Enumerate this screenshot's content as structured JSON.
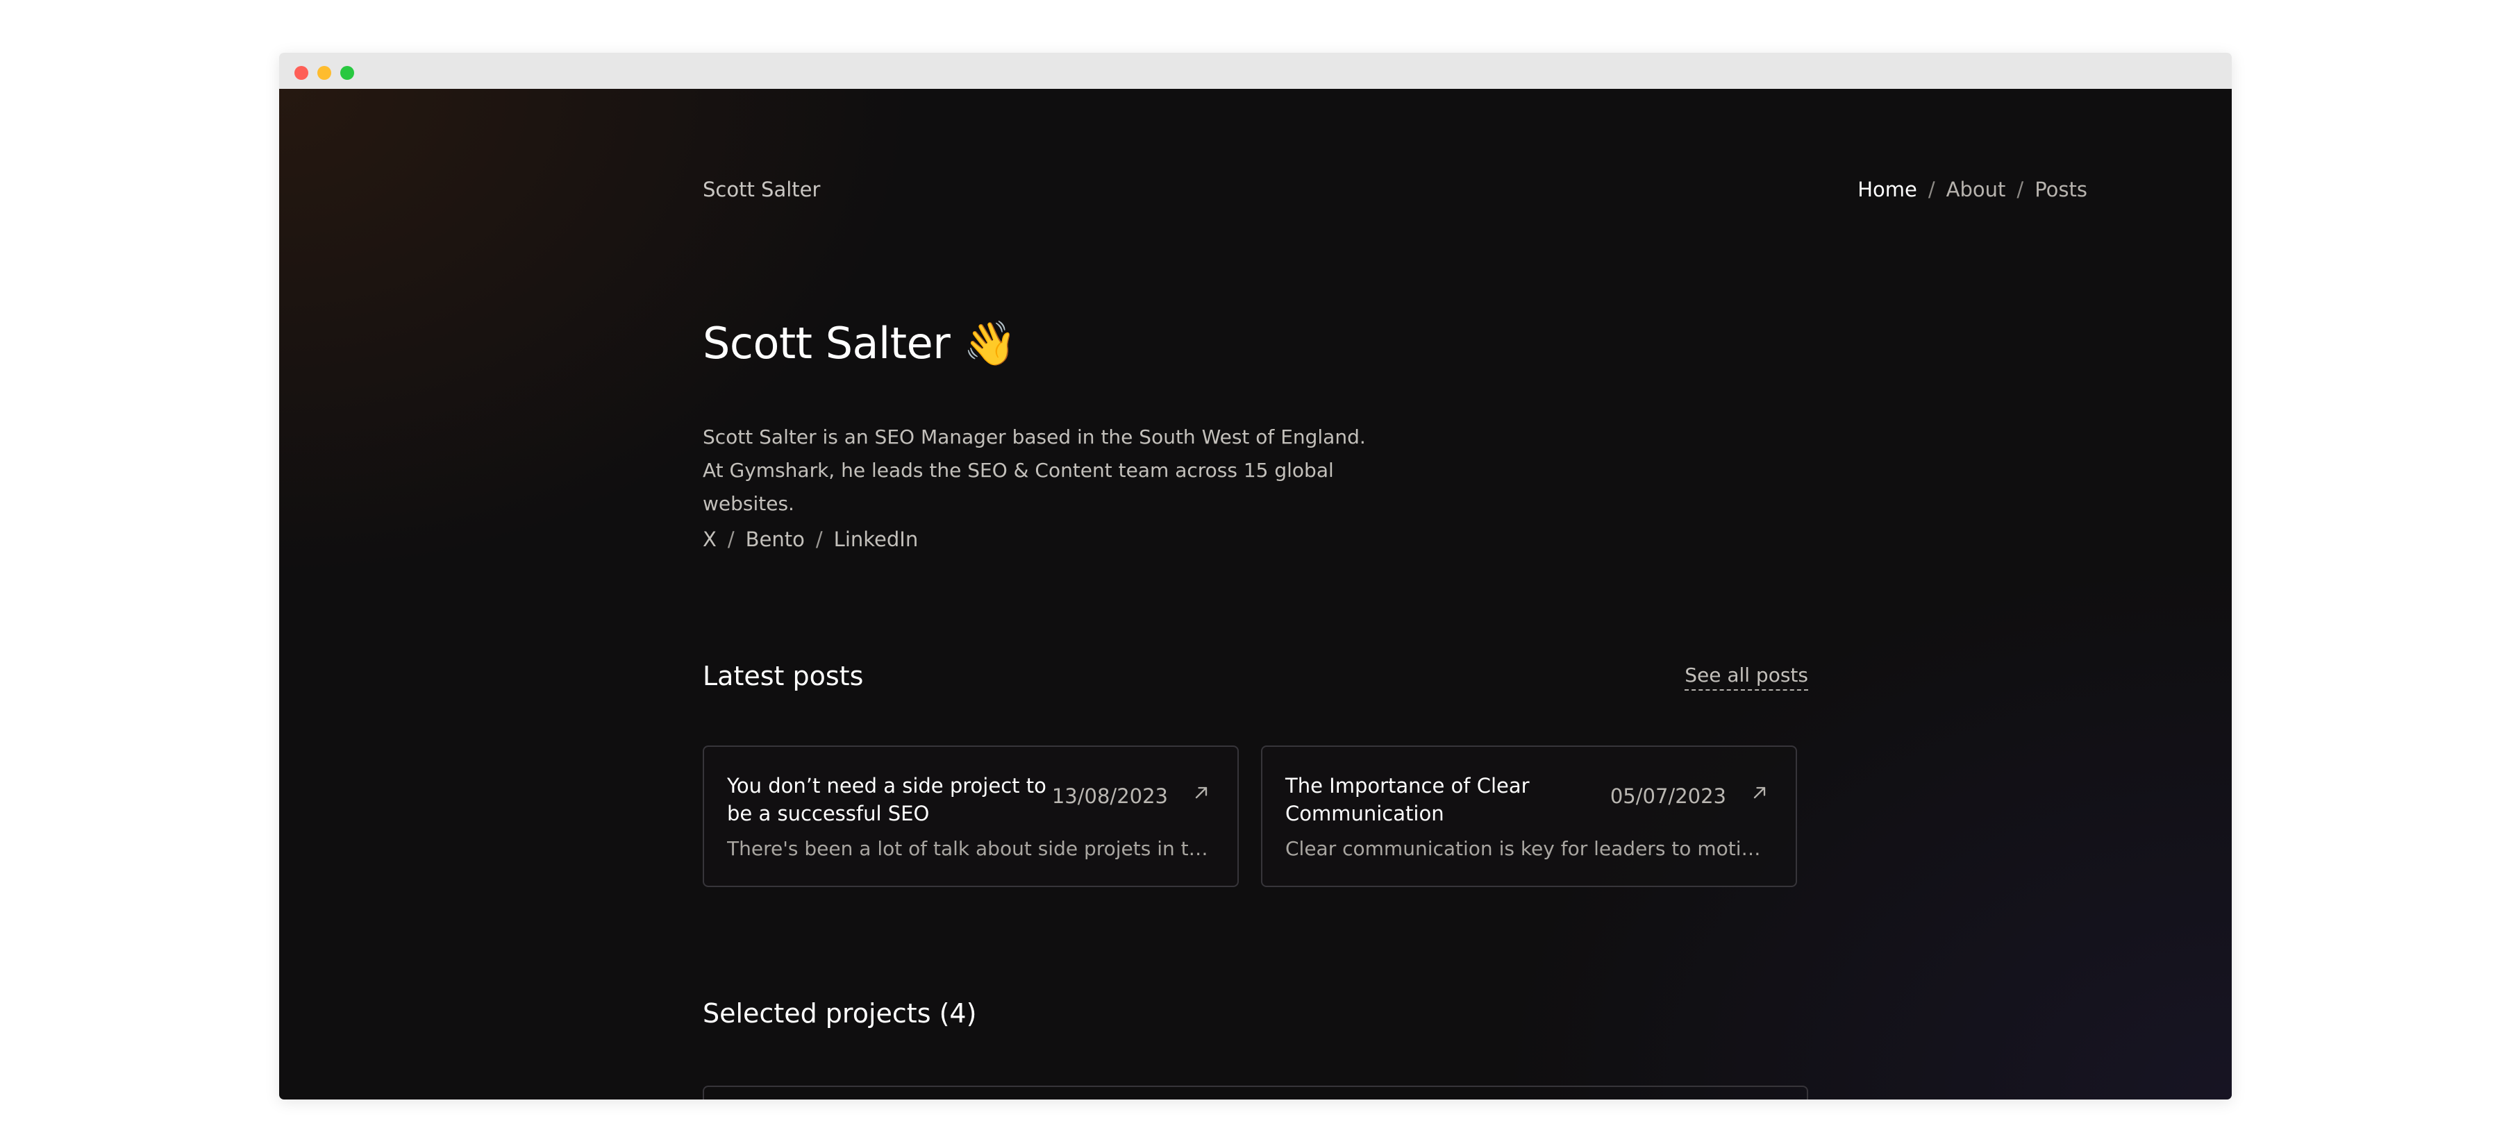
{
  "header": {
    "site_name": "Scott Salter",
    "nav": [
      {
        "label": "Home",
        "active": true
      },
      {
        "label": "About",
        "active": false
      },
      {
        "label": "Posts",
        "active": false
      }
    ],
    "separator": "/"
  },
  "hero": {
    "title": "Scott Salter 👋",
    "bio": "Scott Salter is an SEO Manager based in the South West of England. At Gymshark, he leads the SEO & Content team across 15 global websites.",
    "social_links": [
      "X",
      "Bento",
      "LinkedIn"
    ]
  },
  "latest_posts": {
    "title": "Latest posts",
    "see_all_label": "See all posts",
    "posts": [
      {
        "title": "You don’t need a side project to be a successful SEO",
        "date": "13/08/2023",
        "excerpt": "There's been a lot of talk about side projets in the SEO world recently",
        "icon": "arrow-up-right-icon"
      },
      {
        "title": "The Importance of Clear Communication",
        "date": "05/07/2023",
        "excerpt": "Clear communication is key for leaders to motivate and align their teams",
        "icon": "arrow-up-right-icon"
      }
    ]
  },
  "projects": {
    "title": "Selected projects (4)"
  },
  "colors": {
    "background": "#0f0e0f",
    "text_primary": "#ffffff",
    "text_muted": "#c3c0bb",
    "card_border": "#37353a"
  }
}
